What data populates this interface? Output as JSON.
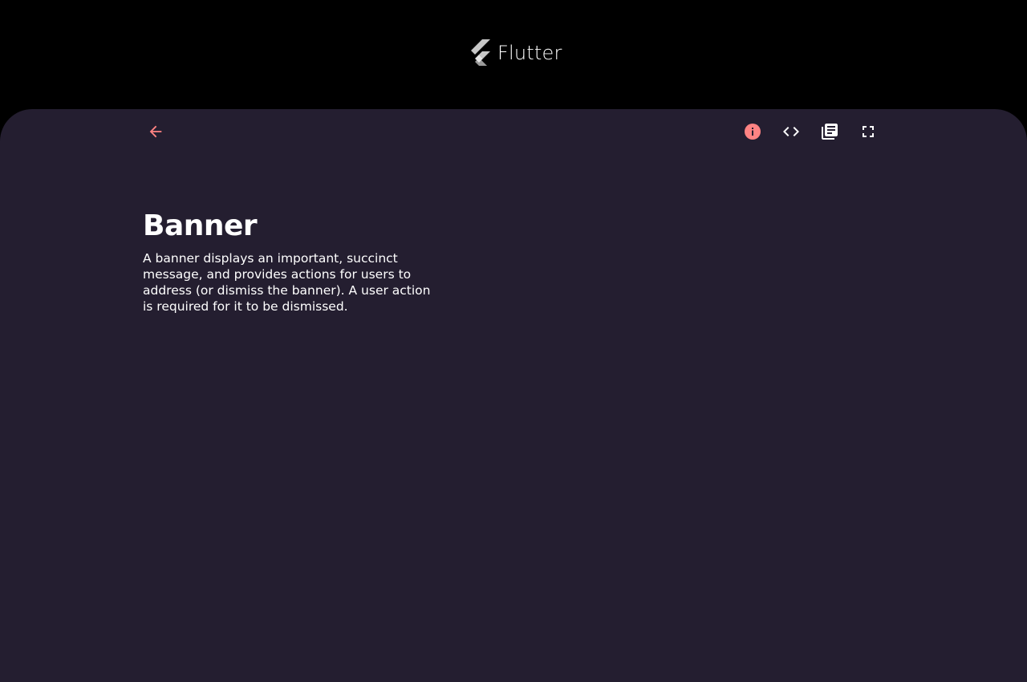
{
  "header": {
    "brand_name": "Flutter",
    "logo_icon": "flutter-logo-icon"
  },
  "toolbar": {
    "back_icon": "arrow-back-icon",
    "info_icon": "info-icon",
    "code_icon": "code-icon",
    "docs_icon": "library-books-icon",
    "fullscreen_icon": "fullscreen-icon"
  },
  "demo": {
    "title": "Banner",
    "description": "A banner displays an important, succinct message, and provides actions for users to address (or dismiss the banner). A user action is required for it to be dismissed."
  },
  "colors": {
    "page_background": "#000000",
    "panel_background": "#241e30",
    "accent": "#ff8383",
    "text": "#ffffff"
  }
}
